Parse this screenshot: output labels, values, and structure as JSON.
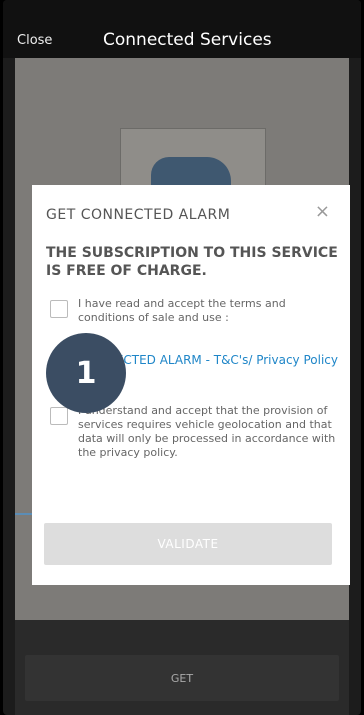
{
  "header": {
    "close_label": "Close",
    "title": "Connected Services"
  },
  "modal": {
    "title": "GET CONNECTED ALARM",
    "close_icon": "×",
    "heading": "THE SUBSCRIPTION TO THIS SERVICE IS FREE OF CHARGE.",
    "checkbox1_text": "I have read and accept the terms and conditions of sale and use :",
    "link_text": "CONNECTED ALARM - T&C's/ Privacy Policy",
    "checkbox2_text": "I understand and accept that the provision of services requires vehicle geolocation and that data will only be processed in accordance with the privacy policy.",
    "validate_label": "VALIDATE"
  },
  "footer": {
    "get_label": "GET"
  },
  "overlay": {
    "step_number": "1"
  },
  "colors": {
    "accent_link": "#1f86c8",
    "badge": "#3b4d63"
  }
}
